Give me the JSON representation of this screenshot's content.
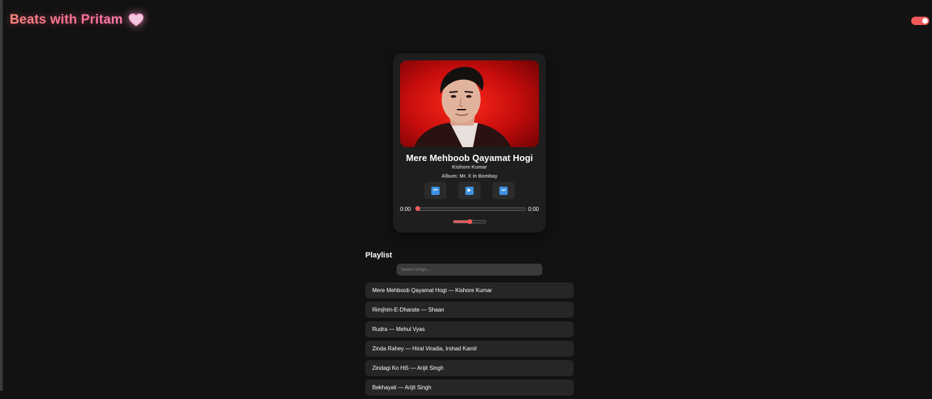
{
  "header": {
    "brand_title": "Beats with Pritam",
    "brand_icon": "heart-icon",
    "theme_toggle_on": true
  },
  "colors": {
    "background": "#121212",
    "card": "#1e1e1e",
    "accent": "#f05a5a",
    "brand_gradient_start": "#ff8a7a",
    "brand_gradient_end": "#ff7fb7",
    "control_icon": "#3d8fe0"
  },
  "player": {
    "cover_description_icon": "album-cover",
    "title": "Mere Mehboob Qayamat Hogi",
    "artist": "Kishore Kumar",
    "album": "Album: Mr. X in Bombay",
    "controls": {
      "previous_icon": "rewind-icon",
      "previous_glyph": "⏮",
      "play_icon": "play-icon",
      "play_glyph": "▶",
      "next_icon": "fast-forward-icon",
      "next_glyph": "⏭"
    },
    "current_time": "0:00",
    "total_time": "0:00",
    "progress": 0,
    "volume": 0.5
  },
  "playlist": {
    "heading": "Playlist",
    "search_placeholder": "Search songs...",
    "items": [
      "Mere Mehboob Qayamat Hogi — Kishore Kumar",
      "Rimjhim-E-Dharate — Shaan",
      "Rudra — Mehul Vyas",
      "Zinda Rahey — Hiral Viradia, Irshad Kamil",
      "Zindagi Ko Hi5 — Arijit Singh",
      "Bekhayali — Arijit Singh"
    ]
  }
}
